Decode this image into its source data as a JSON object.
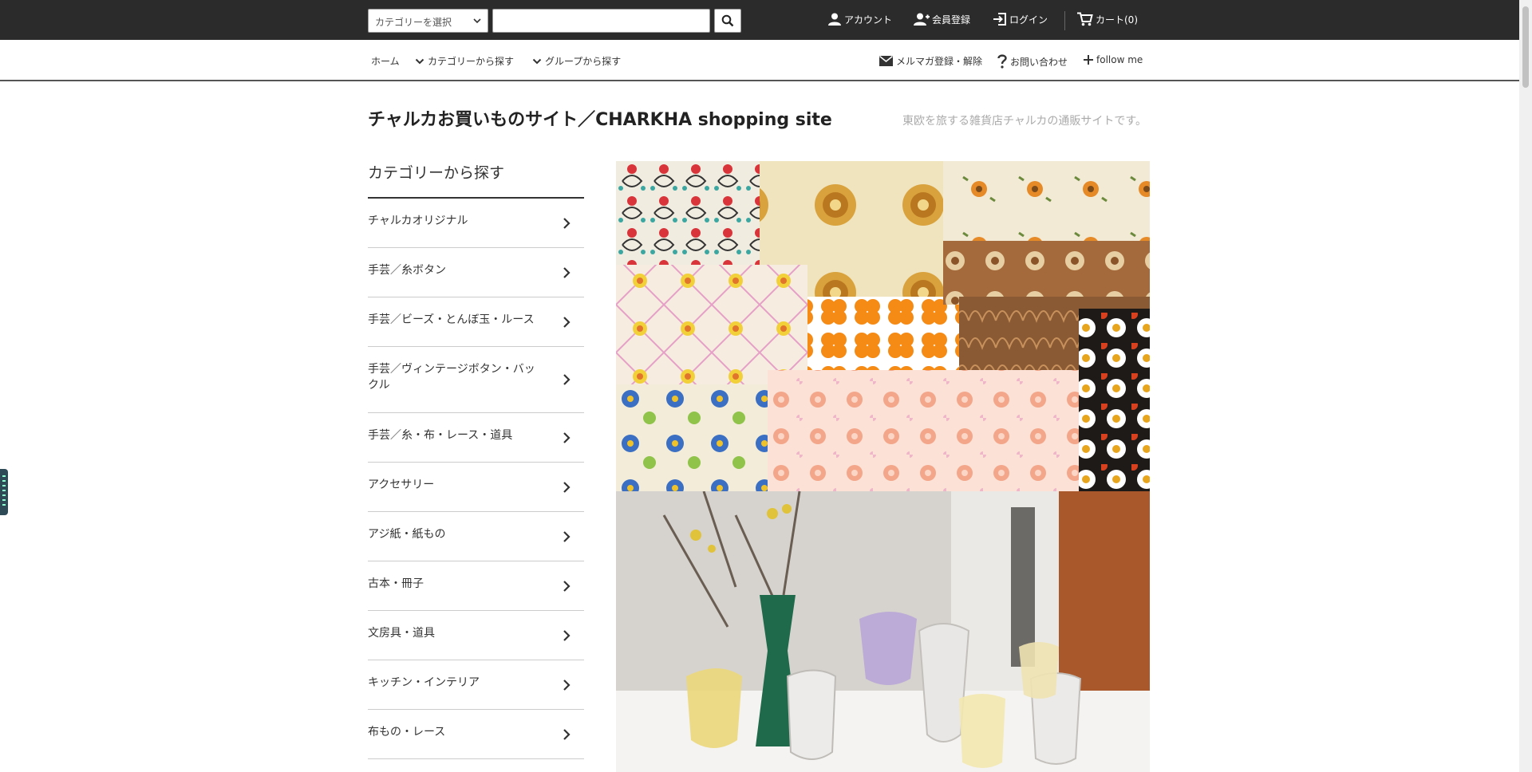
{
  "topbar": {
    "category_select": "カテゴリーを選択",
    "search_value": "",
    "account": "アカウント",
    "register": "会員登録",
    "login": "ログイン",
    "cart": "カート(0)"
  },
  "subnav": {
    "home": "ホーム",
    "by_category": "カテゴリーから探す",
    "by_group": "グループから探す",
    "newsletter": "メルマガ登録・解除",
    "contact": "お問い合わせ",
    "follow": "follow me"
  },
  "site": {
    "title": "チャルカお買いものサイト／CHARKHA shopping site",
    "description": "東欧を旅する雑貨店チャルカの通販サイトです。"
  },
  "sidebar": {
    "heading": "カテゴリーから探す",
    "items": [
      {
        "label": "チャルカオリジナル"
      },
      {
        "label": "手芸／糸ボタン"
      },
      {
        "label": "手芸／ビーズ・とんぼ玉・ルース"
      },
      {
        "label": "手芸／ヴィンテージボタン・バックル"
      },
      {
        "label": "手芸／糸・布・レース・道具"
      },
      {
        "label": "アクセサリー"
      },
      {
        "label": "アジ紙・紙もの"
      },
      {
        "label": "古本・冊子"
      },
      {
        "label": "文房具・道具"
      },
      {
        "label": "キッチン・インテリア"
      },
      {
        "label": "布もの・レース"
      }
    ]
  },
  "colors": {
    "topbar_bg": "#2b2b2b",
    "text": "#333333",
    "muted": "#aaaaaa"
  }
}
